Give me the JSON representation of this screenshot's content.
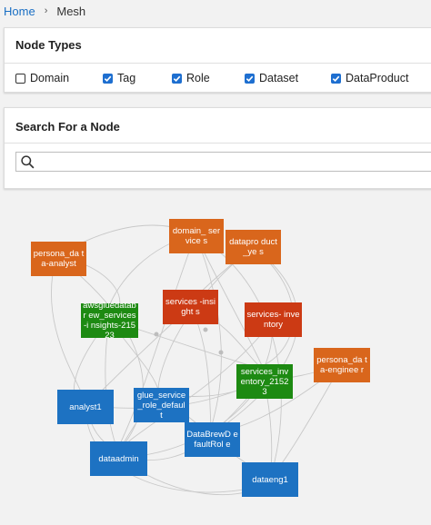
{
  "breadcrumb": {
    "home": "Home",
    "separator": "›",
    "current": "Mesh"
  },
  "node_types": {
    "title": "Node Types",
    "options": [
      {
        "label": "Domain",
        "checked": false
      },
      {
        "label": "Tag",
        "checked": true
      },
      {
        "label": "Role",
        "checked": true
      },
      {
        "label": "Dataset",
        "checked": true
      },
      {
        "label": "DataProduct",
        "checked": true
      }
    ]
  },
  "search": {
    "title": "Search For a Node",
    "value": "",
    "placeholder": ""
  },
  "graph": {
    "colors": {
      "orange": "#d9661c",
      "red": "#cc3a14",
      "green": "#1d8a12",
      "blue": "#1d72c2",
      "edge": "#c8c8c8"
    },
    "nodes": [
      {
        "id": "persona_data_analyst",
        "label": "persona_da ta-analyst"
      },
      {
        "id": "domain_services",
        "label": "domain_ service s"
      },
      {
        "id": "dataproduct_yes",
        "label": "datapro duct_ye s"
      },
      {
        "id": "services_insights",
        "label": "services -insight s"
      },
      {
        "id": "services_inventory",
        "label": "services- inventory"
      },
      {
        "id": "awsgluedatabrew",
        "label": "awsgluedatabr ew_services-i nsights-21523"
      },
      {
        "id": "persona_data_engineer",
        "label": "persona_da ta-enginee r"
      },
      {
        "id": "services_inventory_21523",
        "label": "services_inv entory_21523"
      },
      {
        "id": "analyst1",
        "label": "analyst1"
      },
      {
        "id": "glue_service_role_default",
        "label": "glue_service _role_defaul t"
      },
      {
        "id": "databrew_default_role",
        "label": "DataBrewD efaultRol e"
      },
      {
        "id": "dataadmin",
        "label": "dataadmin"
      },
      {
        "id": "dataeng1",
        "label": "dataeng1"
      }
    ]
  }
}
